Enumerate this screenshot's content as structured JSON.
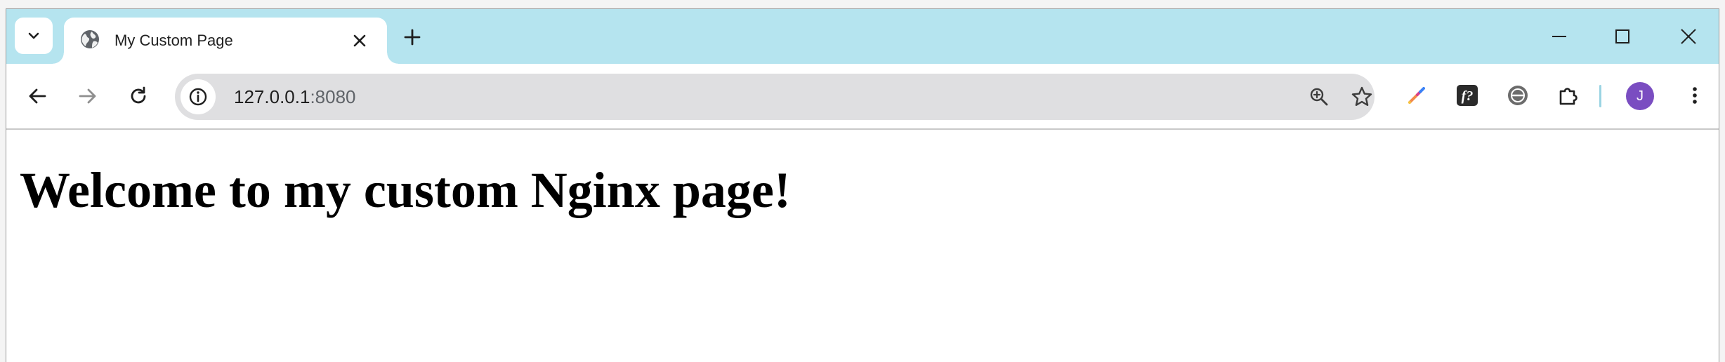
{
  "tab": {
    "title": "My Custom Page",
    "favicon": "globe-icon"
  },
  "address_bar": {
    "host": "127.0.0.1",
    "port": ":8080"
  },
  "toolbar": {
    "profile_initial": "J",
    "profile_color": "#7a4dc1"
  },
  "page": {
    "heading": "Welcome to my custom Nginx page!"
  },
  "colors": {
    "tabstrip": "#b5e4ef",
    "omnibox": "#dfdfe1"
  }
}
